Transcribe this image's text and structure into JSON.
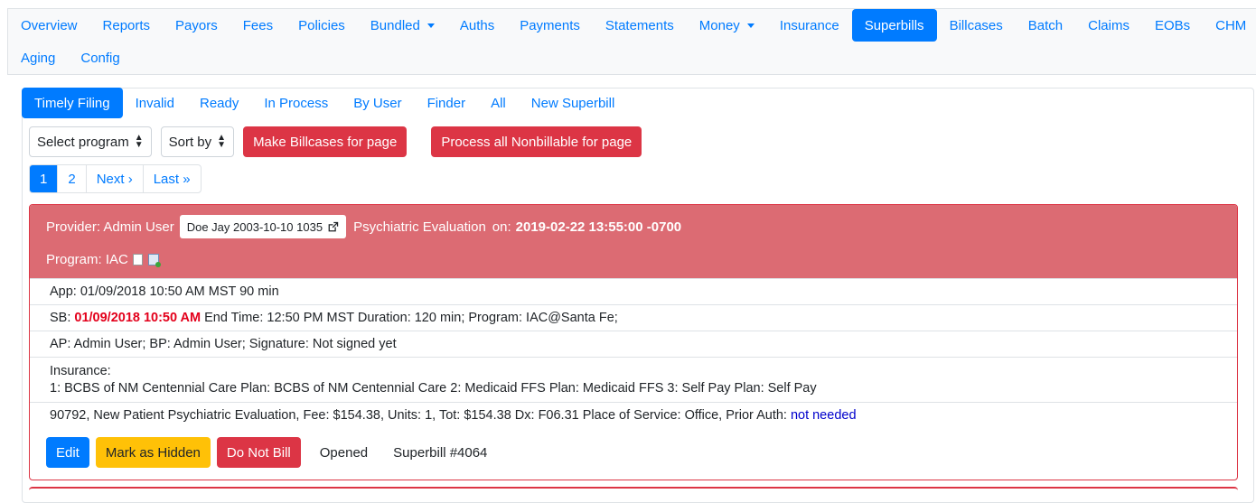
{
  "topnav": {
    "row1": [
      {
        "label": "Overview"
      },
      {
        "label": "Reports"
      },
      {
        "label": "Payors"
      },
      {
        "label": "Fees"
      },
      {
        "label": "Policies"
      },
      {
        "label": "Bundled"
      },
      {
        "label": "Auths"
      },
      {
        "label": "Payments"
      },
      {
        "label": "Statements"
      },
      {
        "label": "Money"
      },
      {
        "label": "Insurance"
      },
      {
        "label": "Superbills"
      },
      {
        "label": "Billcases"
      },
      {
        "label": "Batch"
      },
      {
        "label": "Claims"
      },
      {
        "label": "EOBs"
      },
      {
        "label": "CHM"
      }
    ],
    "row2": [
      {
        "label": "Aging"
      },
      {
        "label": "Config"
      }
    ],
    "active": "Superbills",
    "dropdowns": [
      "Bundled",
      "Money"
    ]
  },
  "subtabs": [
    {
      "label": "Timely Filing"
    },
    {
      "label": "Invalid"
    },
    {
      "label": "Ready"
    },
    {
      "label": "In Process"
    },
    {
      "label": "By User"
    },
    {
      "label": "Finder"
    },
    {
      "label": "All"
    },
    {
      "label": "New Superbill"
    }
  ],
  "controls": {
    "program_select": "Select program",
    "sort_select": "Sort by",
    "make_billcases": "Make Billcases for page",
    "process_nonbillable": "Process all Nonbillable for page"
  },
  "pager": {
    "pages": [
      "1",
      "2"
    ],
    "next": "Next ›",
    "last": "Last »",
    "current": "1"
  },
  "superbill": {
    "provider": "Provider: Admin User",
    "patient": "Doe Jay 2003-10-10 1035",
    "service": "Psychiatric Evaluation",
    "on_label": "on:",
    "datetime": "2019-02-22 13:55:00 -0700",
    "program": "Program: IAC",
    "app_line": "App: 01/09/2018 10:50 AM MST 90 min",
    "sb_prefix": "SB:",
    "sb_datetime": "01/09/2018 10:50 AM",
    "sb_rest": "End Time: 12:50 PM MST Duration: 120 min; Program: IAC@Santa Fe;",
    "ap_line": "AP: Admin User; BP: Admin User; Signature: Not signed yet",
    "insurance_label": "Insurance:",
    "insurance_line": "1: BCBS of NM Centennial Care Plan: BCBS of NM Centennial Care 2: Medicaid FFS Plan: Medicaid FFS 3: Self Pay Plan: Self Pay",
    "service_line": "90792, New Patient Psychiatric Evaluation, Fee: $154.38, Units: 1, Tot: $154.38 Dx: F06.31 Place of Service: Office, Prior Auth:",
    "prior_auth": "not needed",
    "buttons": {
      "edit": "Edit",
      "hide": "Mark as Hidden",
      "do_not_bill": "Do Not Bill"
    },
    "status": "Opened",
    "number": "Superbill #4064"
  },
  "colors": {
    "primary": "#007bff",
    "danger": "#dc3545",
    "panel_head": "#dc6b73",
    "warning": "#ffc107",
    "sb_highlight": "#e3001b"
  }
}
